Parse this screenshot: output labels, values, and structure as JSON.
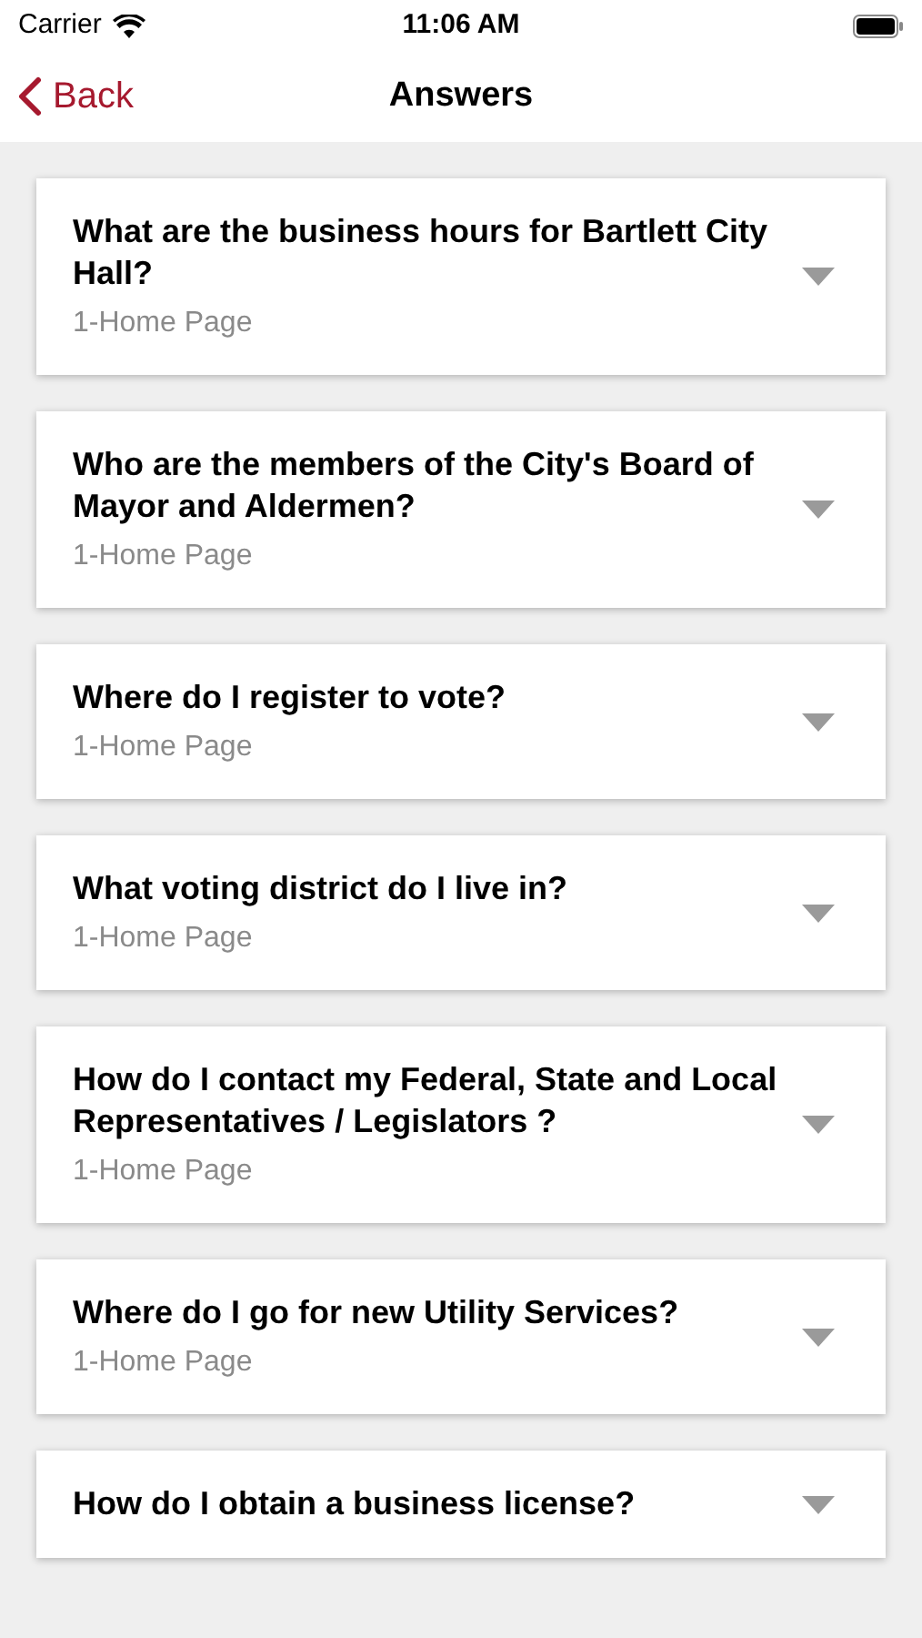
{
  "status_bar": {
    "carrier": "Carrier",
    "time": "11:06 AM"
  },
  "nav": {
    "back": "Back",
    "title": "Answers"
  },
  "questions": [
    {
      "question": "What are the business hours for Bartlett City Hall?",
      "source": "1-Home Page",
      "expanded": false
    },
    {
      "question": "Who are the members of the City's Board of Mayor and Aldermen?",
      "source": "1-Home Page",
      "expanded": false
    },
    {
      "question": "Where do I register to vote?",
      "source": "1-Home Page",
      "expanded": false
    },
    {
      "question": "What voting district do I live in?",
      "source": "1-Home Page",
      "expanded": false
    },
    {
      "question": "How do I contact my Federal, State and Local Representatives / Legislators ?",
      "source": "1-Home Page",
      "expanded": false
    },
    {
      "question": "Where do I go for new Utility Services?",
      "source": "1-Home Page",
      "expanded": false
    },
    {
      "question": "How do I obtain a business license?",
      "expanded": false
    }
  ]
}
